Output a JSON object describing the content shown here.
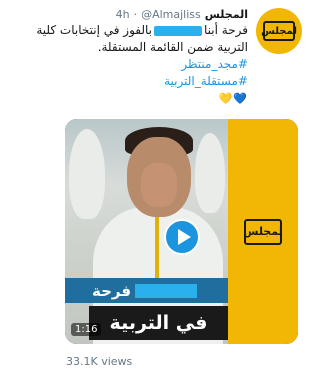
{
  "account": {
    "name": "المجلس",
    "handle": "@Almajliss",
    "dot": "·",
    "time": "4h",
    "avatar_logo": "لمجلس"
  },
  "tweet": {
    "line1_start": "فرحة أبنا",
    "line1_end": "بالفوز في إنتخابات كلية",
    "line2": "التربية ضمن القائمة المستقلة.",
    "hashtags": [
      "#مجد_منتظر",
      "#مستقلة_التربية"
    ],
    "hearts": [
      "💛",
      "💙"
    ]
  },
  "media": {
    "panel_logo": "لمجلس",
    "caption_top": "فرحة",
    "caption_bottom": "في التربية",
    "duration": "1:16",
    "play_icon": "play-icon"
  },
  "stats": {
    "views": "33.1K views"
  },
  "colors": {
    "brand_yellow": "#f2b705",
    "link_blue": "#1b95e0",
    "muted": "#657786"
  }
}
